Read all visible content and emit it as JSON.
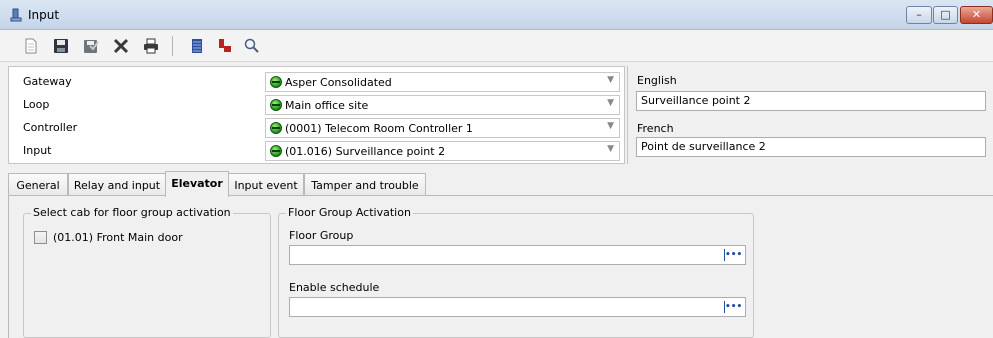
{
  "window": {
    "title": "Input"
  },
  "toolbar": {
    "buttons": [
      {
        "name": "new-icon"
      },
      {
        "name": "save-icon"
      },
      {
        "name": "save-close-icon"
      },
      {
        "name": "delete-icon"
      },
      {
        "name": "print-icon"
      },
      {
        "name": "list-icon"
      },
      {
        "name": "link-icon"
      },
      {
        "name": "search-icon"
      }
    ]
  },
  "header": {
    "gateway": {
      "label": "Gateway",
      "value": "Asper Consolidated"
    },
    "loop": {
      "label": "Loop",
      "value": "Main office site"
    },
    "controller": {
      "label": "Controller",
      "value": "(0001) Telecom Room Controller 1"
    },
    "input": {
      "label": "Input",
      "value": "(01.016) Surveillance point 2"
    },
    "status_color": "#1a8c15"
  },
  "languages": {
    "english": {
      "label": "English",
      "value": "Surveillance point 2"
    },
    "french": {
      "label": "French",
      "value": "Point de surveillance 2"
    }
  },
  "tabs": [
    {
      "label": "General"
    },
    {
      "label": "Relay and input"
    },
    {
      "label": "Elevator",
      "active": true
    },
    {
      "label": "Input event"
    },
    {
      "label": "Tamper and trouble"
    }
  ],
  "elevator": {
    "cab_group": {
      "title": "Select cab for floor group activation",
      "items": [
        {
          "label": "(01.01) Front Main door",
          "checked": false
        }
      ]
    },
    "floor_group_activation": {
      "title": "Floor Group Activation",
      "floor_group": {
        "label": "Floor Group",
        "value": ""
      },
      "enable_schedule": {
        "label": "Enable schedule",
        "value": ""
      },
      "browse_glyph": "•••"
    }
  }
}
